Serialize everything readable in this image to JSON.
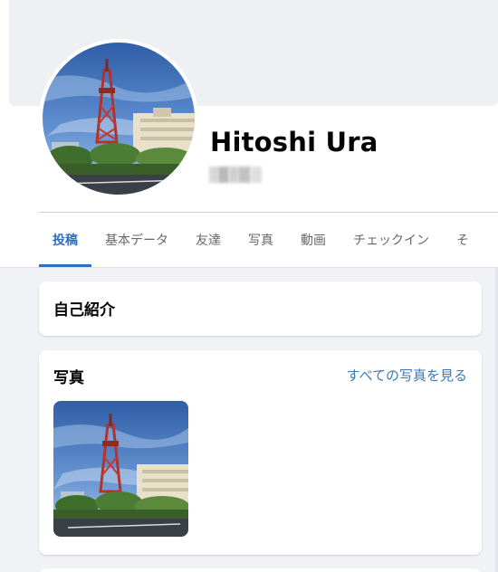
{
  "profile": {
    "name": "Hitoshi Ura",
    "avatar_icon": "tokyo-tower-style-photo",
    "subtitle_blurred": true
  },
  "tabs": [
    {
      "label": "投稿",
      "active": true
    },
    {
      "label": "基本データ",
      "active": false
    },
    {
      "label": "友達",
      "active": false
    },
    {
      "label": "写真",
      "active": false
    },
    {
      "label": "動画",
      "active": false
    },
    {
      "label": "チェックイン",
      "active": false
    },
    {
      "label": "そ",
      "active": false
    }
  ],
  "intro_card": {
    "title": "自己紹介"
  },
  "photos_card": {
    "title": "写真",
    "see_all": "すべての写真を見る",
    "photo_icon": "tv-tower-photo"
  },
  "colors": {
    "accent": "#2f6fc0",
    "link": "#3b78b8",
    "background": "#f0f2f5",
    "text": "#050505",
    "muted": "#65676b"
  }
}
